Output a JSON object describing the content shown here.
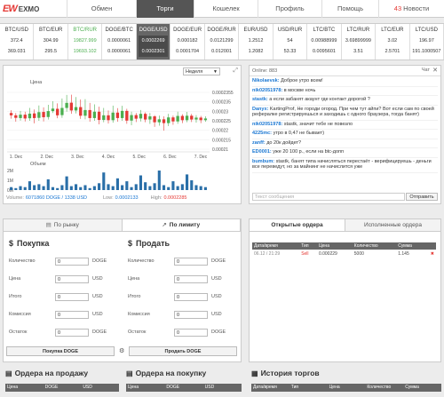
{
  "logo": {
    "mark": "EW",
    "text": "EXMO"
  },
  "nav": [
    {
      "label": "Обмен",
      "active": false
    },
    {
      "label": "Торги",
      "active": true
    },
    {
      "label": "Кошелек",
      "active": false
    },
    {
      "label": "Профиль",
      "active": false
    },
    {
      "label": "Помощь",
      "active": false
    },
    {
      "label": "Новости",
      "badge": "43",
      "active": false
    }
  ],
  "ticker": [
    {
      "pair": "BTC/USD",
      "v1": "372.4",
      "v2": "369.031"
    },
    {
      "pair": "BTC/EUR",
      "v1": "304.99",
      "v2": "295.5"
    },
    {
      "pair": "BTC/RUR",
      "v1": "19827.999",
      "v2": "19693.102",
      "green": true
    },
    {
      "pair": "DOGE/BTC",
      "v1": "0.0000061",
      "v2": "0.0000061"
    },
    {
      "pair": "DOGE/USD",
      "v1": "0.0002269",
      "v2": "0.0002301",
      "active": true
    },
    {
      "pair": "DOGE/EUR",
      "v1": "0.000182",
      "v2": "0.0001704"
    },
    {
      "pair": "DOGE/RUR",
      "v1": "0.0121299",
      "v2": "0.012001"
    },
    {
      "pair": "EUR/USD",
      "v1": "1.2512",
      "v2": "1.2082"
    },
    {
      "pair": "USD/RUR",
      "v1": "54",
      "v2": "53.33"
    },
    {
      "pair": "LTC/BTC",
      "v1": "0.00988999",
      "v2": "0.0095601"
    },
    {
      "pair": "LTC/RUR",
      "v1": "3.69899999",
      "v2": "3.51"
    },
    {
      "pair": "LTC/EUR",
      "v1": "3.02",
      "v2": "2.5701"
    },
    {
      "pair": "LTC/USD",
      "v1": "196.97",
      "v2": "191.1000507"
    }
  ],
  "chart": {
    "period": "Неделя",
    "footer": {
      "volume_label": "Volume:",
      "volume_value": "6071860 DOGE / 1338 USD",
      "low_label": "Low:",
      "low_value": "0.0002133",
      "high_label": "High:",
      "high_value": "0.0002285"
    }
  },
  "chart_data": {
    "type": "candlestick",
    "title": "Цена",
    "volume_title": "Объем",
    "price_ticks": [
      "0.0002355",
      "0.000235",
      "0.00023",
      "0.000225",
      "0.00022",
      "0.000215",
      "0.00021"
    ],
    "date_ticks": [
      "1. Dec",
      "2. Dec",
      "3. Dec",
      "4. Dec",
      "5. Dec",
      "6. Dec",
      "7. Dec"
    ],
    "volume_ticks": [
      "2M",
      "1M",
      "0M"
    ],
    "ylim": [
      0.000209,
      0.000236
    ],
    "candles": [
      {
        "o": 0.0002262,
        "c": 0.0002251,
        "h": 0.0002275,
        "l": 0.0002235
      },
      {
        "o": 0.0002251,
        "c": 0.0002239,
        "h": 0.0002262,
        "l": 0.0002221
      },
      {
        "o": 0.0002238,
        "c": 0.0002254,
        "h": 0.0002272,
        "l": 0.0002226
      },
      {
        "o": 0.0002254,
        "c": 0.0002236,
        "h": 0.0002268,
        "l": 0.0002222
      },
      {
        "o": 0.0002237,
        "c": 0.0002259,
        "h": 0.0002286,
        "l": 0.0002225
      },
      {
        "o": 0.000226,
        "c": 0.0002238,
        "h": 0.0002279,
        "l": 0.0002213
      },
      {
        "o": 0.0002239,
        "c": 0.0002266,
        "h": 0.0002298,
        "l": 0.0002225
      },
      {
        "o": 0.0002267,
        "c": 0.0002242,
        "h": 0.0002289,
        "l": 0.0002222
      },
      {
        "o": 0.0002243,
        "c": 0.0002271,
        "h": 0.0002301,
        "l": 0.0002231
      },
      {
        "o": 0.0002271,
        "c": 0.0002283,
        "h": 0.0002318,
        "l": 0.0002262
      },
      {
        "o": 0.0002282,
        "c": 0.0002251,
        "h": 0.0002308,
        "l": 0.0002237
      },
      {
        "o": 0.0002252,
        "c": 0.0002286,
        "h": 0.0002331,
        "l": 0.0002239
      },
      {
        "o": 0.0002286,
        "c": 0.000231,
        "h": 0.0002348,
        "l": 0.0002268
      },
      {
        "o": 0.0002311,
        "c": 0.0002274,
        "h": 0.0002349,
        "l": 0.0002258
      },
      {
        "o": 0.0002274,
        "c": 0.000229,
        "h": 0.0002338,
        "l": 0.000226
      },
      {
        "o": 0.000229,
        "c": 0.0002249,
        "h": 0.0002326,
        "l": 0.0002234
      },
      {
        "o": 0.0002249,
        "c": 0.0002276,
        "h": 0.0002328,
        "l": 0.0002232
      },
      {
        "o": 0.0002276,
        "c": 0.0002238,
        "h": 0.000231,
        "l": 0.0002221
      },
      {
        "o": 0.0002238,
        "c": 0.0002268,
        "h": 0.0002303,
        "l": 0.0002225
      },
      {
        "o": 0.0002268,
        "c": 0.0002229,
        "h": 0.0002292,
        "l": 0.0002208
      },
      {
        "o": 0.0002229,
        "c": 0.0002251,
        "h": 0.0002286,
        "l": 0.0002218
      },
      {
        "o": 0.0002251,
        "c": 0.0002228,
        "h": 0.0002274,
        "l": 0.0002212
      },
      {
        "o": 0.0002228,
        "c": 0.0002264,
        "h": 0.0002297,
        "l": 0.0002216
      },
      {
        "o": 0.0002264,
        "c": 0.0002238,
        "h": 0.0002285,
        "l": 0.0002221
      },
      {
        "o": 0.0002238,
        "c": 0.0002272,
        "h": 0.0002296,
        "l": 0.0002225
      },
      {
        "o": 0.0002272,
        "c": 0.0002226,
        "h": 0.0002282,
        "l": 0.0002211
      },
      {
        "o": 0.0002226,
        "c": 0.0002252,
        "h": 0.0002268,
        "l": 0.0002204
      },
      {
        "o": 0.0002252,
        "c": 0.0002235,
        "h": 0.0002262,
        "l": 0.0002219
      },
      {
        "o": 0.0002236,
        "c": 0.0002258,
        "h": 0.0002276,
        "l": 0.0002222
      },
      {
        "o": 0.0002258,
        "c": 0.0002231,
        "h": 0.0002265,
        "l": 0.0002218
      },
      {
        "o": 0.0002231,
        "c": 0.0002246,
        "h": 0.0002262,
        "l": 0.000221
      },
      {
        "o": 0.0002246,
        "c": 0.0002218,
        "h": 0.0002252,
        "l": 0.0002196
      },
      {
        "o": 0.0002218,
        "c": 0.0002232,
        "h": 0.000225,
        "l": 0.0002202
      },
      {
        "o": 0.0002232,
        "c": 0.0002214,
        "h": 0.0002246,
        "l": 0.0002178
      },
      {
        "o": 0.0002214,
        "c": 0.0002241,
        "h": 0.0002258,
        "l": 0.00022
      },
      {
        "o": 0.0002241,
        "c": 0.0002222,
        "h": 0.000225,
        "l": 0.0002206
      },
      {
        "o": 0.0002222,
        "c": 0.0002248,
        "h": 0.0002268,
        "l": 0.0002211
      },
      {
        "o": 0.0002248,
        "c": 0.0002228,
        "h": 0.0002256,
        "l": 0.0002214
      },
      {
        "o": 0.0002228,
        "c": 0.0002249,
        "h": 0.0002267,
        "l": 0.0002218
      },
      {
        "o": 0.0002249,
        "c": 0.0002231,
        "h": 0.0002258,
        "l": 0.0002219
      },
      {
        "o": 0.0002231,
        "c": 0.000224,
        "h": 0.0002252,
        "l": 0.0002216
      },
      {
        "o": 0.000224,
        "c": 0.0002228,
        "h": 0.0002248,
        "l": 0.0002214
      },
      {
        "o": 0.0002228,
        "c": 0.0002236,
        "h": 0.0002246,
        "l": 0.000222
      }
    ],
    "volumes": [
      0.3,
      0.2,
      0.4,
      0.3,
      0.9,
      0.5,
      0.6,
      0.4,
      1.1,
      0.3,
      0.2,
      0.5,
      1.4,
      0.4,
      0.6,
      0.3,
      0.5,
      0.2,
      0.4,
      0.7,
      1.8,
      0.6,
      0.4,
      1.2,
      0.5,
      0.9,
      0.3,
      0.6,
      1.5,
      0.8,
      0.4,
      0.7,
      2.1,
      0.5,
      0.3,
      0.9,
      0.4,
      0.6,
      1.6,
      1.0,
      0.5,
      0.4,
      0.3
    ]
  },
  "chat": {
    "online_label": "Online: 883",
    "flag_label": "Чат",
    "input_placeholder": "Текст сообщения",
    "send_label": "Отправить",
    "messages": [
      {
        "user": "Nikolaevsk:",
        "text": "Доброе утро всем!"
      },
      {
        "user": "nik02051978:",
        "text": "в москве ночь"
      },
      {
        "user": "stastk:",
        "text": "а если забанят акаунт где контакт дорогой ?"
      },
      {
        "user": "Danyx:",
        "text": "KartingProf, Не городи огород. При чем тут айпи? Вот если сам по своей рефералке регистрируешься и заходишь с одного браузера, тогда банят)"
      },
      {
        "user": "nik02051978:",
        "text": "stastk, значит тебе не повезло"
      },
      {
        "user": "4225mc:",
        "text": "утро в 0,47 не бывает)"
      },
      {
        "user": "zanff:",
        "text": "до 20к дойдет?"
      },
      {
        "user": "ED0001:",
        "text": "уже 20 100 р., если на btc-допп"
      },
      {
        "user": "bumbum:",
        "text": "stastk, банят типа начисляться перестаёт - верифицируешь - деньги все переведут, но за майнинг не начислится уже"
      }
    ]
  },
  "trade": {
    "tab_market": "По рынку",
    "tab_limit": "По лимиту",
    "buy": {
      "title": "Покупка",
      "rows": [
        {
          "label": "Количество",
          "value": "0",
          "currency": "DOGE"
        },
        {
          "label": "Цена",
          "value": "0",
          "currency": "USD"
        },
        {
          "label": "Итого",
          "value": "0",
          "currency": "USD"
        },
        {
          "label": "Комиссия",
          "value": "0",
          "currency": "USD"
        },
        {
          "label": "Остаток",
          "value": "0",
          "currency": "DOGE"
        }
      ],
      "button": "Покупка DOGE"
    },
    "sell": {
      "title": "Продать",
      "rows": [
        {
          "label": "Количество",
          "value": "0",
          "currency": "DOGE"
        },
        {
          "label": "Цена",
          "value": "0",
          "currency": "USD"
        },
        {
          "label": "Итого",
          "value": "0",
          "currency": "USD"
        },
        {
          "label": "Комиссия",
          "value": "0",
          "currency": "USD"
        },
        {
          "label": "Остаток",
          "value": "0",
          "currency": "DOGE"
        }
      ],
      "button": "Продать DOGE"
    }
  },
  "orders": {
    "tab_open": "Открытые ордера",
    "tab_done": "Исполненные ордера",
    "columns": [
      "Дата/время",
      "Тип",
      "Цена",
      "Количество",
      "Сумма"
    ],
    "rows": [
      {
        "date": "06.12 / 21:29",
        "type": "Sell",
        "price": "0.000229",
        "qty": "5000",
        "sum": "1.145",
        "del": "✖"
      }
    ]
  },
  "bottom": [
    {
      "title": "Ордера на продажу",
      "cols": [
        "Цена",
        "DOGE",
        "USD"
      ]
    },
    {
      "title": "Ордера на покупку",
      "cols": [
        "Цена",
        "DOGE",
        "USD"
      ]
    },
    {
      "title": "История торгов",
      "cols": [
        "Дата/время",
        "Тип",
        "Цена",
        "Количество",
        "Сумма"
      ]
    }
  ]
}
